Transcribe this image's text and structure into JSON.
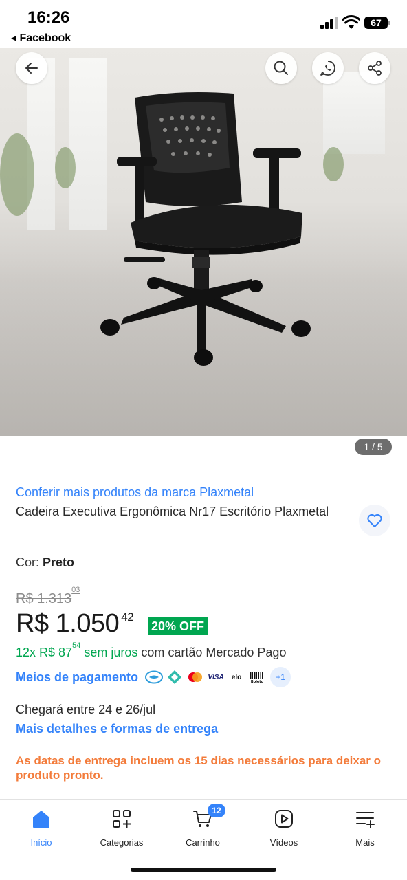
{
  "status_bar": {
    "time": "16:26",
    "back_app": "◂ Facebook",
    "battery": "67"
  },
  "gallery": {
    "counter": "1 / 5",
    "icons": [
      "back-arrow-icon",
      "search-icon",
      "whatsapp-icon",
      "share-icon"
    ]
  },
  "product": {
    "brand_link": "Conferir mais produtos da marca Plaxmetal",
    "title": "Cadeira Executiva Ergonômica Nr17 Escritório Plaxmetal",
    "color_label": "Cor:",
    "color_value": "Preto",
    "old_price_main": "R$ 1.313",
    "old_price_cents": "03",
    "price_main": "R$ 1.050",
    "price_cents": "42",
    "discount": "20% OFF",
    "installments_prefix": "12x R$ 87",
    "installments_cents": "54",
    "installments_free": " sem juros",
    "installments_suffix": " com cartão Mercado Pago",
    "payment_link": "Meios de pagamento",
    "payment_icons": [
      "Mercado Pago",
      "Pix",
      "Mastercard",
      "VISA",
      "elo",
      "Boleto"
    ],
    "payment_more": "+1",
    "arrival": "Chegará entre 24 e 26/jul",
    "delivery_link": "Mais detalhes e formas de entrega",
    "notice": "As datas de entrega incluem os 15 dias necessários para deixar o produto pronto."
  },
  "colors": {
    "accent": "#3483fa",
    "green": "#00a650",
    "orange": "#f37b3a"
  },
  "bottom_nav": {
    "home": "Início",
    "categories": "Categorias",
    "cart": "Carrinho",
    "cart_count": "12",
    "videos": "Vídeos",
    "more": "Mais"
  }
}
